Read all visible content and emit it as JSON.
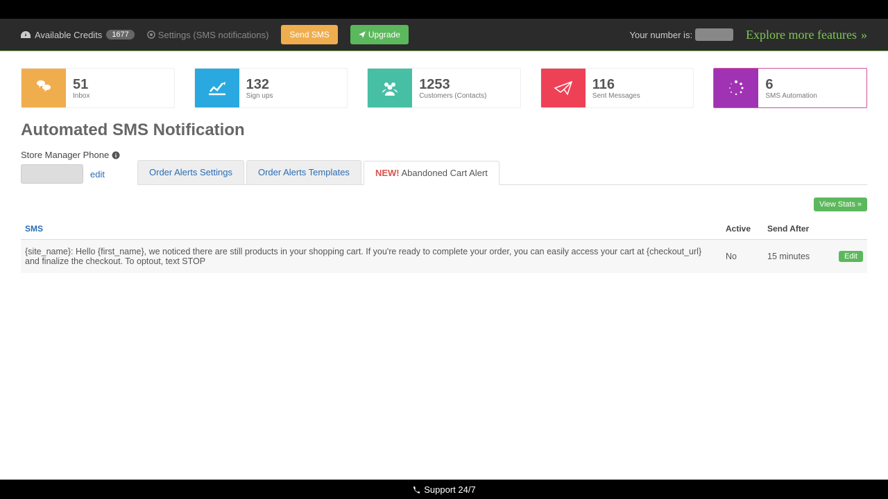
{
  "topbar": {
    "credits_label": "Available Credits",
    "credits_count": "1677",
    "settings_label": "Settings (SMS notifications)",
    "send_sms": "Send SMS",
    "upgrade": "Upgrade",
    "your_number_label": "Your number is:",
    "explore": "Explore more features"
  },
  "stats": [
    {
      "value": "51",
      "label": "Inbox"
    },
    {
      "value": "132",
      "label": "Sign ups"
    },
    {
      "value": "1253",
      "label": "Customers (Contacts)"
    },
    {
      "value": "116",
      "label": "Sent Messages"
    },
    {
      "value": "6",
      "label": "SMS Automation"
    }
  ],
  "page_title": "Automated SMS Notification",
  "phone_label": "Store Manager Phone",
  "edit_label": "edit",
  "tabs": {
    "order_settings": "Order Alerts Settings",
    "order_templates": "Order Alerts Templates",
    "new_badge": "NEW!",
    "cart_alert": "Abandoned Cart Alert"
  },
  "view_stats": "View Stats »",
  "table": {
    "h_sms": "SMS",
    "h_active": "Active",
    "h_send_after": "Send After",
    "row": {
      "sms": "{site_name}: Hello {first_name}, we noticed there are still products in your shopping cart. If you're ready to complete your order, you can easily access your cart at {checkout_url} and finalize the checkout. To optout, text STOP",
      "active": "No",
      "send_after": "15 minutes",
      "edit": "Edit"
    }
  },
  "footer": "Support 24/7"
}
